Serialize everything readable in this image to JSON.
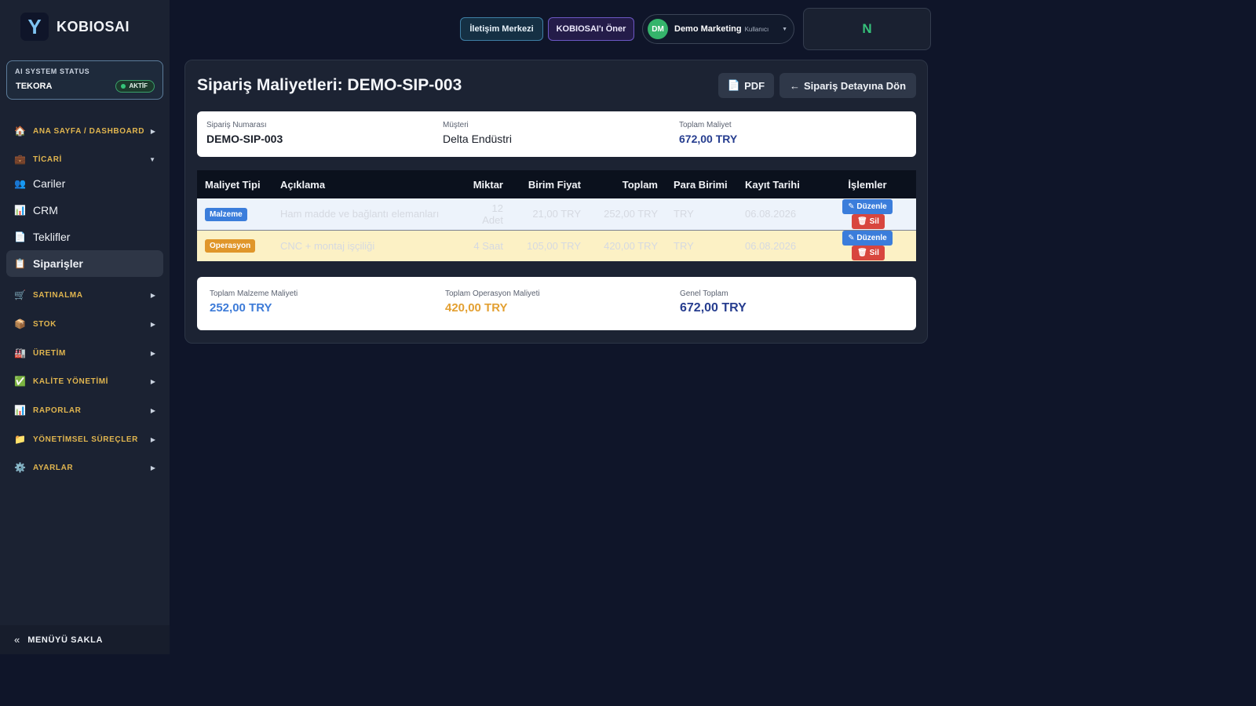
{
  "brand": {
    "logo": "Y",
    "name": "KOBIOSAI"
  },
  "status": {
    "title": "AI SYSTEM STATUS",
    "name": "TEKORA",
    "badge": "AKTİF"
  },
  "nav": {
    "home": {
      "icon": "🏠",
      "label": "ANA SAYFA / DASHBOARD",
      "arrow": "▶"
    },
    "ticari": {
      "icon": "💼",
      "label": "TİCARİ",
      "arrow": "▼"
    },
    "items": [
      {
        "icon": "👥",
        "label": "Cariler"
      },
      {
        "icon": "📊",
        "label": "CRM"
      },
      {
        "icon": "📄",
        "label": "Teklifler"
      },
      {
        "icon": "📋",
        "label": "Siparişler"
      }
    ],
    "groups": [
      {
        "icon": "🛒",
        "label": "SATINALMA",
        "arrow": "▶"
      },
      {
        "icon": "📦",
        "label": "STOK",
        "arrow": "▶"
      },
      {
        "icon": "🏭",
        "label": "ÜRETİM",
        "arrow": "▶"
      },
      {
        "icon": "✅",
        "label": "KALİTE YÖNETİMİ",
        "arrow": "▶"
      },
      {
        "icon": "📊",
        "label": "RAPORLAR",
        "arrow": "▶"
      },
      {
        "icon": "📁",
        "label": "YÖNETİMSEL SÜREÇLER",
        "arrow": "▶"
      },
      {
        "icon": "⚙️",
        "label": "AYARLAR",
        "arrow": "▶"
      }
    ],
    "footer": {
      "icon": "«",
      "label": "MENÜYÜ SAKLA"
    }
  },
  "topbar": {
    "iletisim": "İletişim Merkezi",
    "oner": "KOBIOSAI'ı Öner",
    "user_initials": "DM",
    "user_name": "Demo Marketing",
    "user_role": "Kullanıcı",
    "caret": "▼",
    "n_box": "N"
  },
  "page": {
    "title": "Sipariş Maliyetleri: DEMO-SIP-003",
    "pdf_icon": "📄",
    "pdf_label": "PDF",
    "back_icon": "←",
    "back_label": "Sipariş Detayına Dön"
  },
  "info": {
    "order_label": "Sipariş Numarası",
    "order_value": "DEMO-SIP-003",
    "customer_label": "Müşteri",
    "customer_value": "Delta Endüstri",
    "total_label": "Toplam Maliyet",
    "total_value": "672,00 TRY"
  },
  "table": {
    "headers": [
      "Maliyet Tipi",
      "Açıklama",
      "Miktar",
      "Birim Fiyat",
      "Toplam",
      "Para Birimi",
      "Kayıt Tarihi",
      "İşlemler"
    ],
    "rows": [
      {
        "type": "Malzeme",
        "desc": "Ham madde ve bağlantı elemanları",
        "qty": "12 Adet",
        "unit": "21,00 TRY",
        "total": "252,00 TRY",
        "currency": "TRY",
        "date": "06.08.2026",
        "edit": "✎ Düzenle",
        "del": "🗑 Sil"
      },
      {
        "type": "Operasyon",
        "desc": "CNC + montaj işçiliği",
        "qty": "4 Saat",
        "unit": "105,00 TRY",
        "total": "420,00 TRY",
        "currency": "TRY",
        "date": "06.08.2026",
        "edit": "✎ Düzenle",
        "del": "🗑 Sil"
      }
    ]
  },
  "summary": {
    "material_label": "Toplam Malzeme Maliyeti",
    "material_value": "252,00 TRY",
    "operation_label": "Toplam Operasyon Maliyeti",
    "operation_value": "420,00 TRY",
    "grand_label": "Genel Toplam",
    "grand_value": "672,00 TRY"
  },
  "colors": {
    "accent_blue": "#3d7bd8",
    "accent_orange": "#e3a032",
    "navy": "#263d8f",
    "active_green": "#35c47a"
  }
}
